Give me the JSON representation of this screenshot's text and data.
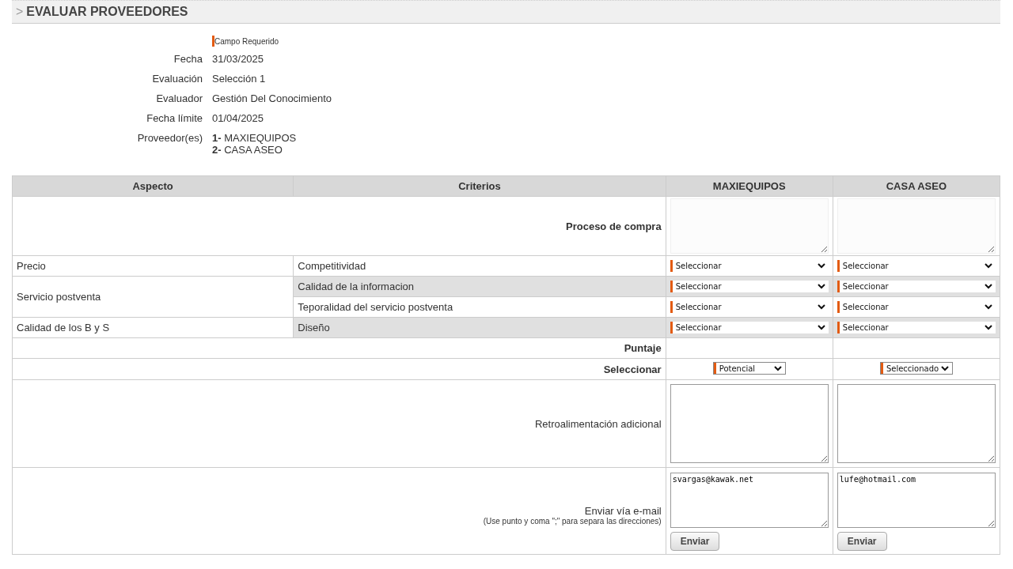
{
  "header": {
    "marker": ">",
    "title": "EVALUAR PROVEEDORES"
  },
  "required_legend": "Campo Requerido",
  "fields": [
    {
      "label": "Fecha",
      "values": [
        "31/03/2025"
      ]
    },
    {
      "label": "Evaluación",
      "values": [
        "Selección 1"
      ]
    },
    {
      "label": "Evaluador",
      "values": [
        "Gestión Del Conocimiento"
      ]
    },
    {
      "label": "Fecha límite",
      "values": [
        "01/04/2025"
      ]
    },
    {
      "label": "Proveedor(es)",
      "values": [
        "**1-** MAXIEQUIPOS",
        "**2-** CASA ASEO"
      ]
    }
  ],
  "table": {
    "columns": [
      "Aspecto",
      "Criterios",
      "MAXIEQUIPOS",
      "CASA ASEO"
    ],
    "process_label": "Proceso de compra",
    "aspects": [
      {
        "name": "Precio",
        "criteria": [
          {
            "name": "Competitividad",
            "selects": [
              "Seleccionar",
              "Seleccionar"
            ]
          }
        ]
      },
      {
        "name": "Servicio postventa",
        "criteria": [
          {
            "name": "Calidad de la informacion",
            "selects": [
              "Seleccionar",
              "Seleccionar"
            ]
          },
          {
            "name": "Teporalidad del servicio postventa",
            "selects": [
              "Seleccionar",
              "Seleccionar"
            ]
          }
        ]
      },
      {
        "name": "Calidad de los B y S",
        "criteria": [
          {
            "name": "Diseño",
            "selects": [
              "Seleccionar",
              "Seleccionar"
            ]
          }
        ]
      }
    ],
    "score_label": "Puntaje",
    "status": {
      "label": "Seleccionar",
      "values": [
        "Potencial",
        "Seleccionado"
      ]
    },
    "feedback_label": "Retroalimentación adicional",
    "email": {
      "label": "Enviar vía e-mail",
      "note": "(Use punto y coma \";\" para separa las direcciones)",
      "values": [
        "svargas@kawak.net",
        "lufe@hotmail.com"
      ],
      "buttons": [
        "Enviar",
        "Enviar"
      ]
    }
  }
}
